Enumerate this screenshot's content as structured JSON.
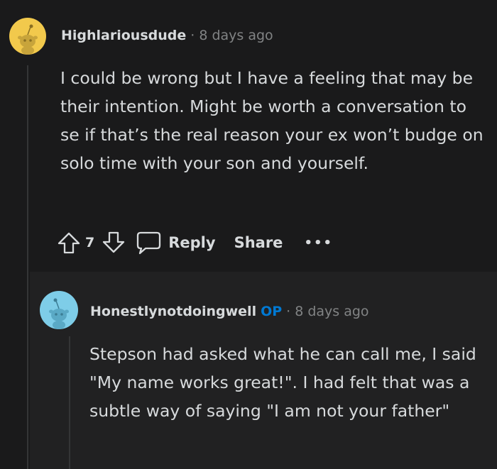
{
  "comments": [
    {
      "username": "Highlariousdude",
      "age": "8 days ago",
      "separator": "·",
      "body": "I could be wrong but I have a feeling that may be their intention. Might be worth a conversation to se if that’s the real reason your ex won’t budge on solo time with your son and yourself.",
      "votes": "7",
      "actions": {
        "reply": "Reply",
        "share": "Share",
        "more": "•••"
      },
      "avatar_color": "#f2c94c"
    },
    {
      "username": "Honestlynotdoingwell",
      "badge": "OP",
      "age": "8 days ago",
      "separator": "·",
      "body": "Stepson had asked what he can call me, I said \"My name works great!\". I had felt that was a subtle way of saying \"I am not your father\"",
      "avatar_color": "#7ecde8"
    }
  ],
  "icons": {
    "upvote": "arrow-up-outline",
    "downvote": "arrow-down-outline",
    "reply": "speech-bubble",
    "more": "ellipsis"
  },
  "colors": {
    "background": "#1a1a1b",
    "nested_background": "#212122",
    "text": "#d7dadc",
    "muted": "#818384",
    "op_badge": "#0079d3"
  }
}
